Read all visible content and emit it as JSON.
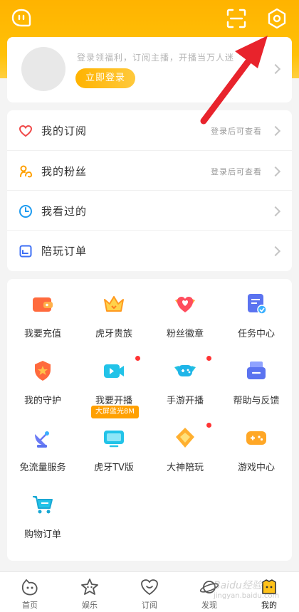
{
  "header": {
    "icons": [
      "message-icon",
      "scan-icon",
      "settings-icon"
    ]
  },
  "profile": {
    "login_tip": "登录领福利，订阅主播，开播当万人迷",
    "login_button": "立即登录"
  },
  "menu": {
    "items": [
      {
        "label": "我的订阅",
        "hint": "登录后可查看",
        "icon": "heart-icon",
        "color": "#f04848"
      },
      {
        "label": "我的粉丝",
        "hint": "登录后可查看",
        "icon": "fans-icon",
        "color": "#ffa000"
      },
      {
        "label": "我看过的",
        "hint": "",
        "icon": "clock-icon",
        "color": "#1e9bf0"
      },
      {
        "label": "陪玩订单",
        "hint": "",
        "icon": "order-icon",
        "color": "#3d6ff5"
      }
    ]
  },
  "grid": {
    "items": [
      {
        "label": "我要充值",
        "icon": "wallet-icon"
      },
      {
        "label": "虎牙贵族",
        "icon": "crown-icon"
      },
      {
        "label": "粉丝徽章",
        "icon": "badge-heart-icon"
      },
      {
        "label": "任务中心",
        "icon": "task-icon"
      },
      {
        "label": "我的守护",
        "icon": "shield-icon"
      },
      {
        "label": "我要开播",
        "icon": "camera-icon"
      },
      {
        "label": "手游开播",
        "icon": "gamepad-wing-icon"
      },
      {
        "label": "帮助与反馈",
        "icon": "mailbox-icon"
      },
      {
        "label": "免流量服务",
        "icon": "satellite-icon"
      },
      {
        "label": "虎牙TV版",
        "icon": "tv-icon",
        "badge": "大屏蓝光8M"
      },
      {
        "label": "大神陪玩",
        "icon": "diamond-icon"
      },
      {
        "label": "游戏中心",
        "icon": "gamepad-icon"
      },
      {
        "label": "购物订单",
        "icon": "cart-icon"
      }
    ]
  },
  "tabbar": {
    "tabs": [
      {
        "label": "首页",
        "icon": "home-icon"
      },
      {
        "label": "娱乐",
        "icon": "star-icon"
      },
      {
        "label": "订阅",
        "icon": "heart-tab-icon"
      },
      {
        "label": "发现",
        "icon": "planet-icon"
      },
      {
        "label": "我的",
        "icon": "profile-icon"
      }
    ],
    "active": "我的"
  },
  "watermark": {
    "text": "Baidu经验",
    "sub": "jingyan.baidu.com"
  },
  "colors": {
    "brand": "#ffb300",
    "red_dot": "#ff3333",
    "arrow": "#e8232c"
  }
}
